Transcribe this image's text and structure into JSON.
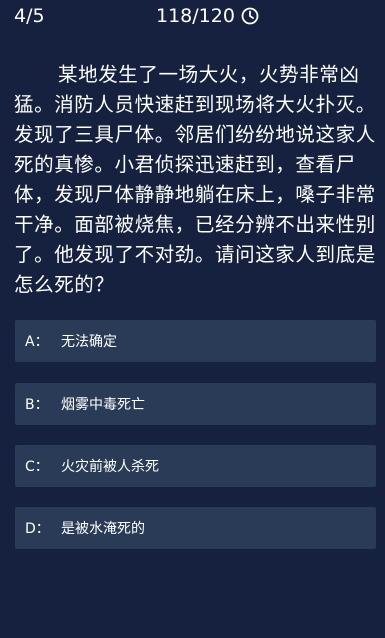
{
  "header": {
    "progress": "4/5",
    "timer": "118/120"
  },
  "question": {
    "text": "某地发生了一场大火，火势非常凶猛。消防人员快速赶到现场将大火扑灭。发现了三具尸体。邻居们纷纷地说这家人死的真惨。小君侦探迅速赶到，查看尸体，发现尸体静静地躺在床上，嗓子非常干净。面部被烧焦，已经分辨不出来性别了。他发现了不对劲。请问这家人到底是怎么死的？"
  },
  "options": [
    {
      "letter": "A：",
      "text": "无法确定"
    },
    {
      "letter": "B：",
      "text": "烟雾中毒死亡"
    },
    {
      "letter": "C：",
      "text": "火灾前被人杀死"
    },
    {
      "letter": "D：",
      "text": "是被水淹死的"
    }
  ],
  "colors": {
    "background": "#15213f",
    "option_background": "#2a3b57",
    "text": "#ffffff"
  },
  "icons": {
    "timer": "clock-icon"
  }
}
